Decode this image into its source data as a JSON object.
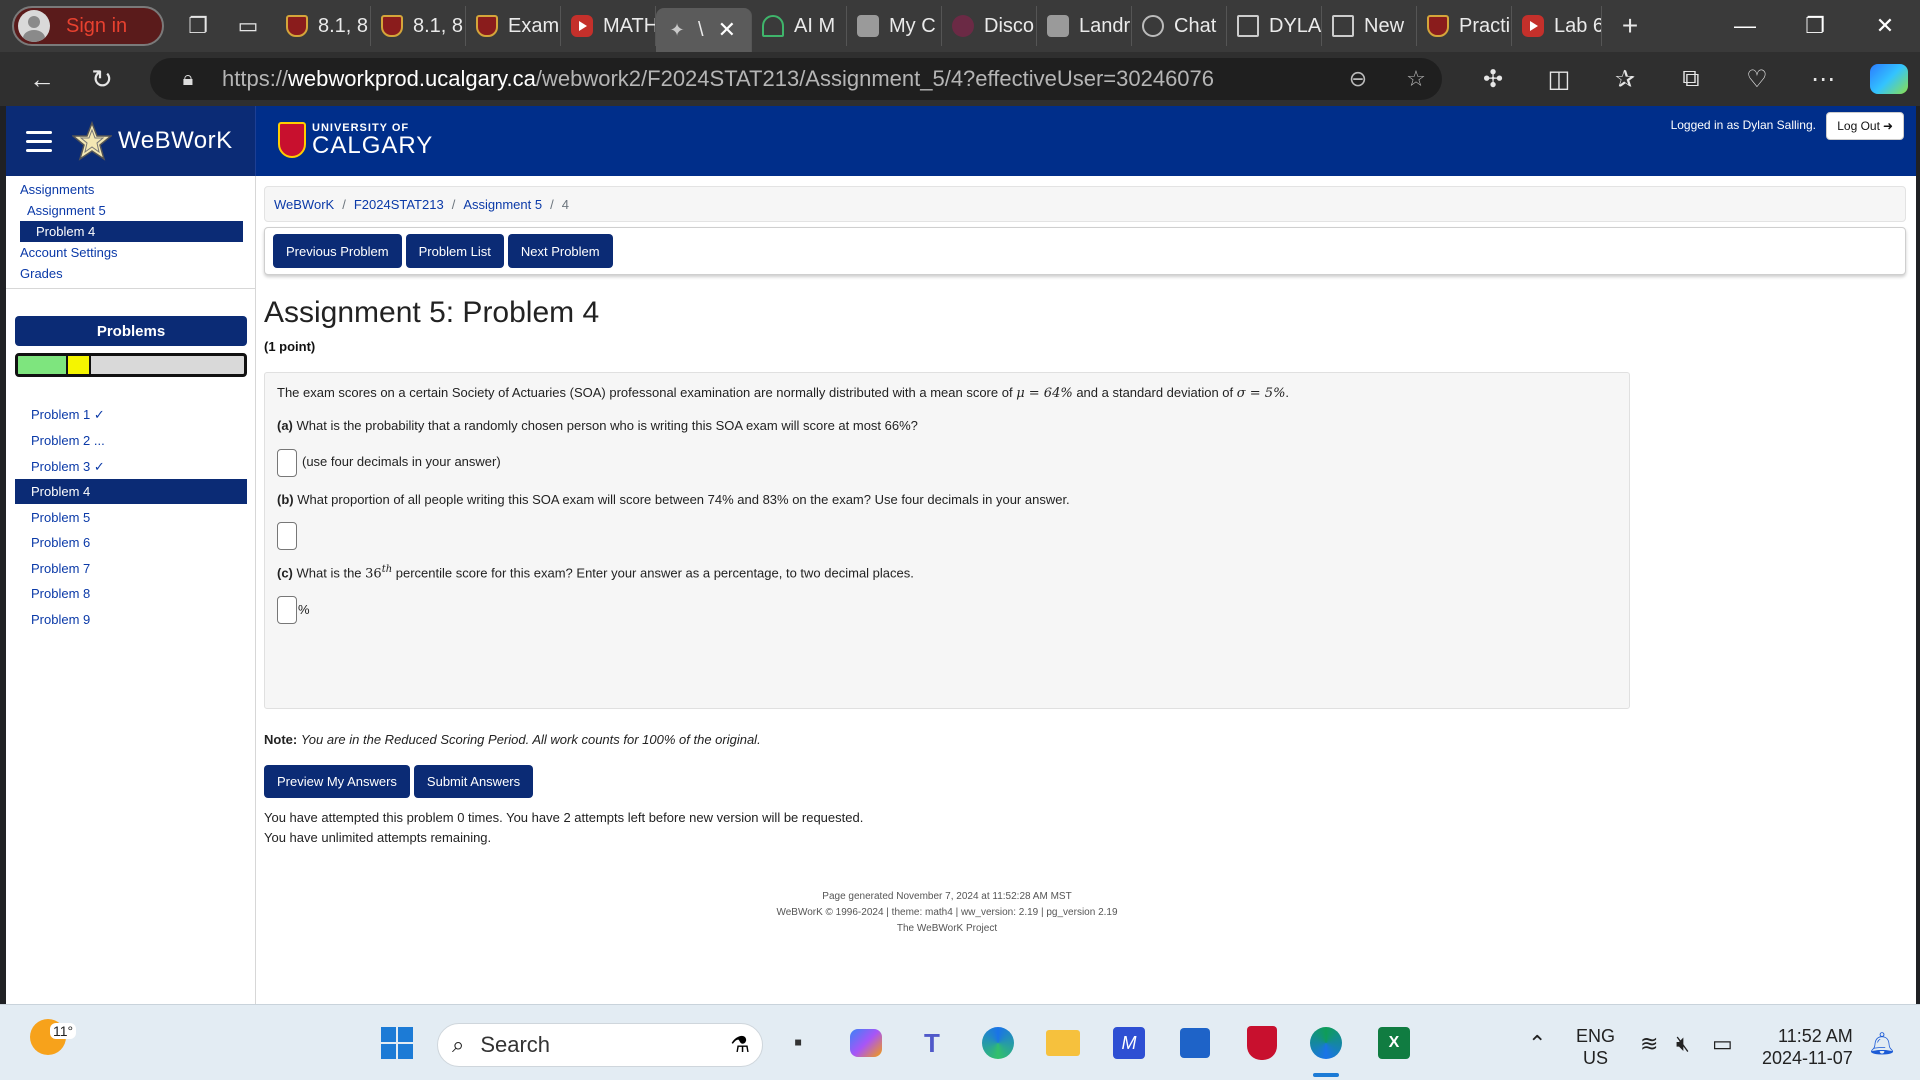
{
  "browser": {
    "profile_label": "Sign in",
    "tabs": [
      {
        "label": "8.1, 8",
        "favicon": "shield"
      },
      {
        "label": "8.1, 8",
        "favicon": "shield"
      },
      {
        "label": "Exam",
        "favicon": "shield"
      },
      {
        "label": "MATH",
        "favicon": "yt"
      },
      {
        "label": "\\",
        "favicon": "ww",
        "active": true
      },
      {
        "label": "AI M",
        "favicon": "ai"
      },
      {
        "label": "My C",
        "favicon": "gray"
      },
      {
        "label": "Disco",
        "favicon": "discord"
      },
      {
        "label": "Landr",
        "favicon": "gray"
      },
      {
        "label": "Chat",
        "favicon": "chat"
      },
      {
        "label": "DYLA",
        "favicon": "doc"
      },
      {
        "label": "New",
        "favicon": "doc"
      },
      {
        "label": "Practi",
        "favicon": "shield"
      },
      {
        "label": "Lab 6",
        "favicon": "yt"
      }
    ],
    "url_prefix": "https://",
    "url_host": "webworkprod.ucalgary.ca",
    "url_path": "/webwork2/F2024STAT213/Assignment_5/4?effectiveUser=30246076"
  },
  "header": {
    "app_title": "WeBWorK",
    "uni_small": "UNIVERSITY OF",
    "uni_big": "CALGARY",
    "logged_in": "Logged in as Dylan Salling.",
    "logout": "Log Out"
  },
  "sidebar": {
    "assignments": "Assignments",
    "assignment5": "Assignment 5",
    "problem4": "Problem 4",
    "account_settings": "Account Settings",
    "grades": "Grades",
    "problems_heading": "Problems",
    "problems": [
      "Problem 1 ✓",
      "Problem 2 ...",
      "Problem 3 ✓",
      "Problem 4",
      "Problem 5",
      "Problem 6",
      "Problem 7",
      "Problem 8",
      "Problem 9"
    ]
  },
  "breadcrumb": [
    "WeBWorK",
    "F2024STAT213",
    "Assignment 5",
    "4"
  ],
  "nav": {
    "prev": "Previous Problem",
    "list": "Problem List",
    "next": "Next Problem"
  },
  "problem": {
    "title": "Assignment 5: Problem 4",
    "points": "(1 point)",
    "intro_a": "The exam scores on a certain Society of Actuaries (SOA) professonal examination are normally distributed with a mean score of ",
    "mu": "μ = 64%",
    "intro_b": " and a standard deviation of ",
    "sigma": "σ = 5%",
    "intro_c": ".",
    "qa_label": "(a)",
    "qa_text": " What is the probability that a randomly chosen person who is writing this SOA exam will score at most 66%?",
    "qa_hint": "(use four decimals in your answer)",
    "qb_label": "(b)",
    "qb_text": " What proportion of all people writing this SOA exam will score between 74% and 83% on the exam? Use four decimals in your answer.",
    "qc_label": "(c)",
    "qc_text_a": " What is the ",
    "qc_num": "36",
    "qc_sup": "th",
    "qc_text_b": " percentile score for this exam? Enter your answer as a percentage, to two decimal places.",
    "qc_unit": "%"
  },
  "note": {
    "label": "Note:",
    "text": "You are in the Reduced Scoring Period. All work counts for 100% of the original."
  },
  "actions": {
    "preview": "Preview My Answers",
    "submit": "Submit Answers"
  },
  "attempts": {
    "line1": "You have attempted this problem 0 times. You have 2 attempts left before new version will be requested.",
    "line2": "You have unlimited attempts remaining."
  },
  "footer": {
    "line1": "Page generated November 7, 2024 at 11:52:28 AM MST",
    "line2": "WeBWorK © 1996-2024 | theme: math4 | ww_version: 2.19 | pg_version 2.19",
    "line3": "The WeBWorK Project"
  },
  "taskbar": {
    "temperature": "11°",
    "search_label": "Search",
    "lang_line1": "ENG",
    "lang_line2": "US",
    "time": "11:52 AM",
    "date": "2024-11-07"
  }
}
